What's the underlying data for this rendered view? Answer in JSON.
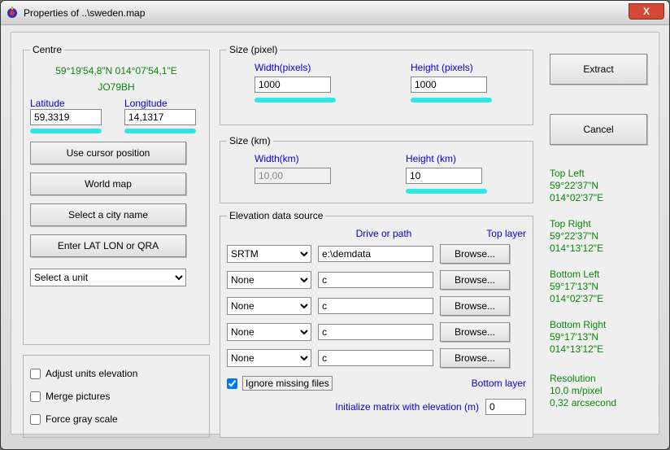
{
  "window": {
    "title": "Properties of ..\\sweden.map",
    "close": "X"
  },
  "centre": {
    "legend": "Centre",
    "coord": "59°19'54,8\"N 014°07'54,1\"E",
    "qra": "JO79BH",
    "lat_label": "Latitude",
    "lon_label": "Longitude",
    "lat_value": "59,3319",
    "lon_value": "14,1317",
    "btn_cursor": "Use cursor position",
    "btn_world": "World map",
    "btn_city": "Select a city name",
    "btn_latlon": "Enter LAT LON or QRA",
    "unit_select": "Select a unit"
  },
  "sizepx": {
    "legend": "Size (pixel)",
    "width_label": "Width(pixels)",
    "height_label": "Height (pixels)",
    "width_value": "1000",
    "height_value": "1000"
  },
  "sizekm": {
    "legend": "Size (km)",
    "width_label": "Width(km)",
    "height_label": "Height (km)",
    "width_value": "10,00",
    "height_value": "10"
  },
  "elev": {
    "legend": "Elevation data source",
    "drive_label": "Drive or path",
    "top_label": "Top layer",
    "bottom_label": "Bottom layer",
    "rows": [
      {
        "source": "SRTM",
        "path": "e:\\demdata",
        "browse": "Browse..."
      },
      {
        "source": "None",
        "path": "c",
        "browse": "Browse..."
      },
      {
        "source": "None",
        "path": "c",
        "browse": "Browse..."
      },
      {
        "source": "None",
        "path": "c",
        "browse": "Browse..."
      },
      {
        "source": "None",
        "path": "c",
        "browse": "Browse..."
      }
    ],
    "ignore_label": "Ignore missing files",
    "init_label": "Initialize matrix with elevation (m)",
    "init_value": "0"
  },
  "checks": {
    "adjust": "Adjust units elevation",
    "merge": "Merge pictures",
    "gray": "Force gray scale"
  },
  "main_buttons": {
    "extract": "Extract",
    "cancel": "Cancel"
  },
  "corners": {
    "tl": {
      "label": "Top Left",
      "lat": "59°22'37\"N",
      "lon": "014°02'37\"E"
    },
    "tr": {
      "label": "Top Right",
      "lat": "59°22'37\"N",
      "lon": "014°13'12\"E"
    },
    "bl": {
      "label": "Bottom Left",
      "lat": "59°17'13\"N",
      "lon": "014°02'37\"E"
    },
    "br": {
      "label": "Bottom Right",
      "lat": "59°17'13\"N",
      "lon": "014°13'12\"E"
    },
    "res": {
      "label": "Resolution",
      "mp": "10,0 m/pixel",
      "arc": "0,32 arcsecond"
    }
  }
}
